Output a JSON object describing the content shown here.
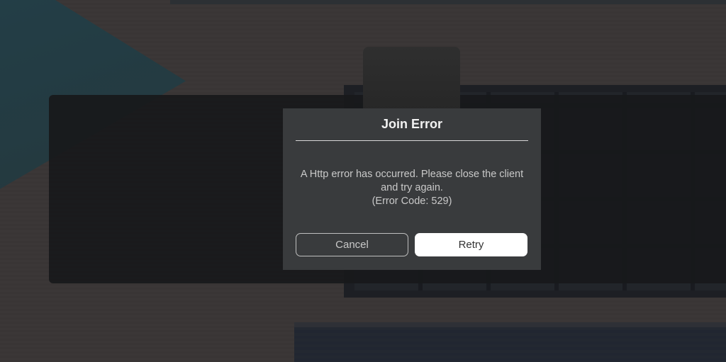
{
  "dialog": {
    "title": "Join Error",
    "message_lines": [
      "A Http error has occurred. Please close the client",
      "and try again.",
      "(Error Code: 529)"
    ],
    "cancel_label": "Cancel",
    "retry_label": "Retry"
  },
  "colors": {
    "dialog_bg": "#393b3d",
    "primary_button_bg": "#ffffff",
    "text_light": "#f2f2f2",
    "text_muted": "#c9c9c9"
  }
}
